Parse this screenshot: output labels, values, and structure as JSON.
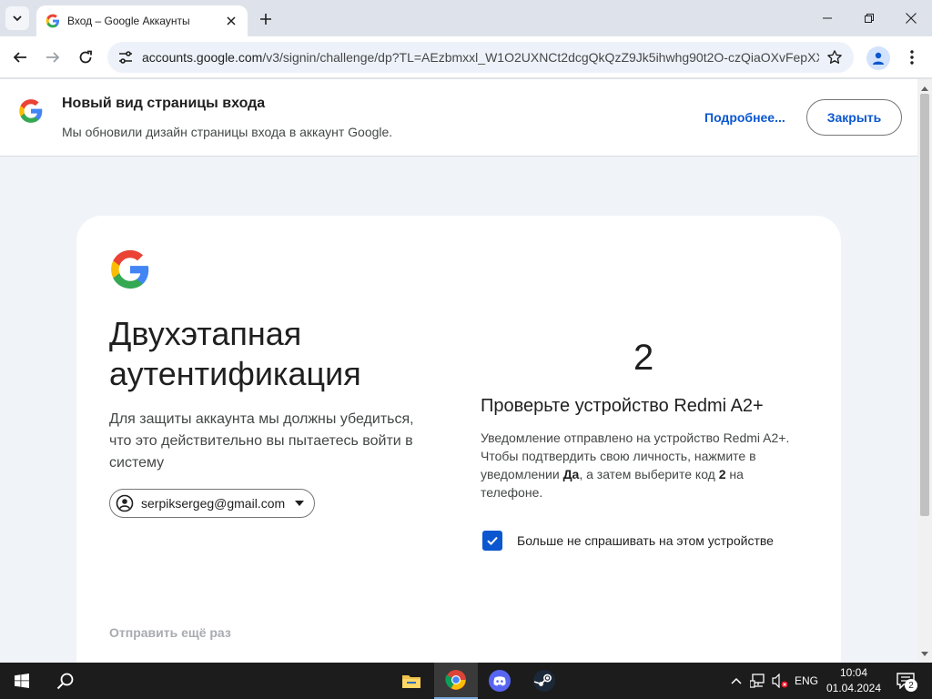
{
  "browser": {
    "tab_title": "Вход – Google Аккаунты",
    "url_domain": "accounts.google.com",
    "url_path": "/v3/signin/challenge/dp?TL=AEzbmxxl_W1O2UXNCt2dcgQkQzZ9Jk5ihwhg90t2O-czQiaOXvFepXX..."
  },
  "banner": {
    "title": "Новый вид страницы входа",
    "subtitle": "Мы обновили дизайн страницы входа в аккаунт Google.",
    "more_link": "Подробнее...",
    "close_button": "Закрыть"
  },
  "card": {
    "heading_line1": "Двухэтапная",
    "heading_line2": "аутентификация",
    "description": "Для защиты аккаунта мы должны убедиться, что это действительно вы пытаетесь войти в систему",
    "account_email": "serpiksergeg@gmail.com",
    "code": "2",
    "verify_title": "Проверьте устройство Redmi A2+",
    "verify_text_1": "Уведомление отправлено на устройство Redmi A2+. Чтобы подтвердить свою личность, нажмите в уведомлении ",
    "verify_bold_yes": "Да",
    "verify_text_2": ", а затем выберите код ",
    "verify_bold_code": "2",
    "verify_text_3": " на телефоне.",
    "remember_label": "Больше не спрашивать на этом устройстве",
    "remember_checked": true,
    "resend_link": "Отправить ещё раз"
  },
  "taskbar": {
    "language": "ENG",
    "time": "10:04",
    "date": "01.04.2024",
    "notifications_count": "2"
  },
  "colors": {
    "accent": "#0b57d0",
    "chrome_frame": "#dee3eb",
    "page_bg": "#f0f4f9",
    "taskbar": "#1c1c1c"
  },
  "icons": {
    "tab_search": "chevron-down-icon",
    "favicon": "google-g-icon",
    "back": "arrow-left-icon",
    "forward": "arrow-right-icon",
    "reload": "reload-icon",
    "site_info": "tune-icon",
    "bookmark": "star-icon",
    "profile": "person-icon",
    "menu": "three-dots-icon"
  }
}
